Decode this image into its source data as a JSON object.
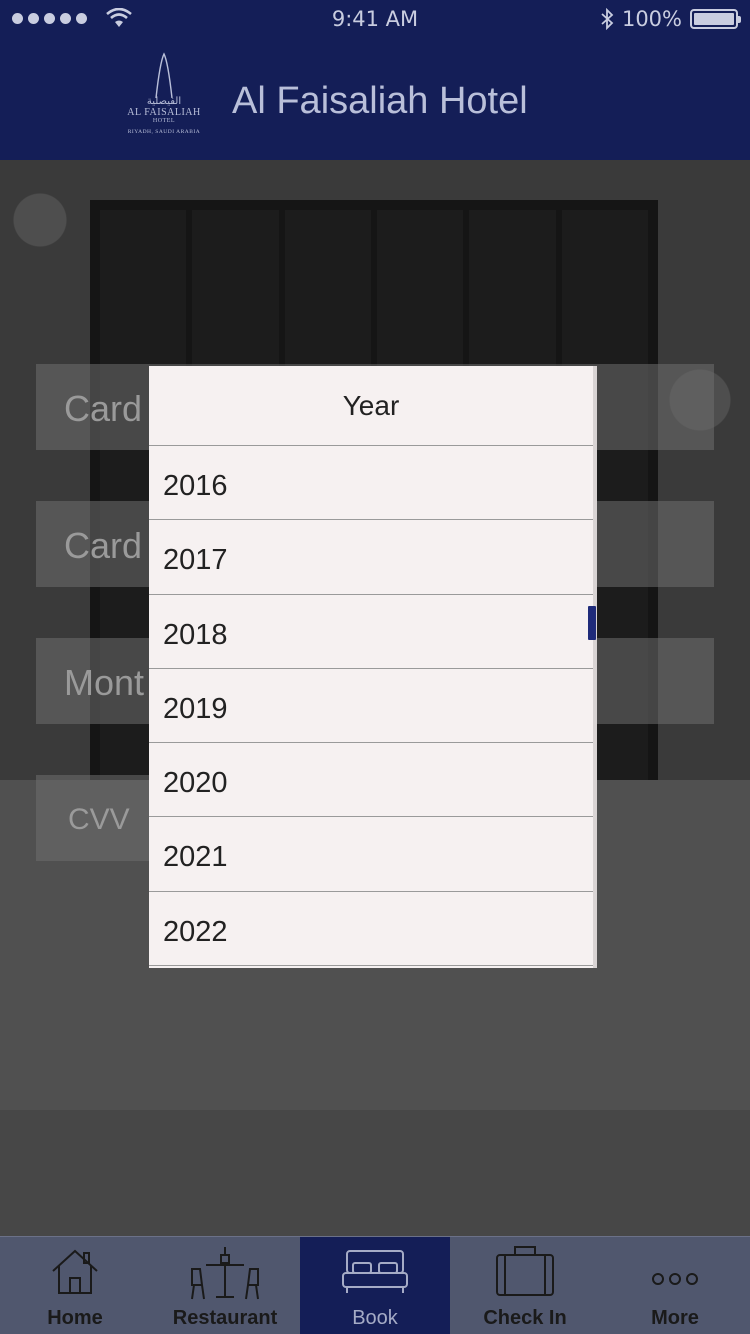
{
  "status_bar": {
    "time": "9:41 AM",
    "battery": "100%"
  },
  "header": {
    "title": "Al Faisaliah Hotel",
    "logo": {
      "arabic": "الفيصلية",
      "name": "AL FAISALIAH",
      "sub": "HOTEL",
      "location": "RIYADH, SAUDI ARABIA"
    }
  },
  "form": {
    "card_name_placeholder": "Card",
    "card_number_placeholder": "Card",
    "month_placeholder": "Mont",
    "cvv_placeholder": "CVV"
  },
  "picker": {
    "title": "Year",
    "options": [
      "2016",
      "2017",
      "2018",
      "2019",
      "2020",
      "2021",
      "2022"
    ]
  },
  "tabs": [
    {
      "label": "Home",
      "icon": "home-icon",
      "active": false
    },
    {
      "label": "Restaurant",
      "icon": "restaurant-icon",
      "active": false
    },
    {
      "label": "Book",
      "icon": "bed-icon",
      "active": true
    },
    {
      "label": "Check In",
      "icon": "suitcase-icon",
      "active": false
    },
    {
      "label": "More",
      "icon": "more-icon",
      "active": false
    }
  ],
  "colors": {
    "brand_navy": "#141e57",
    "tab_bar": "#50576e",
    "picker_bg": "#f6f1f1",
    "scroll_thumb": "#1f2b7a"
  }
}
